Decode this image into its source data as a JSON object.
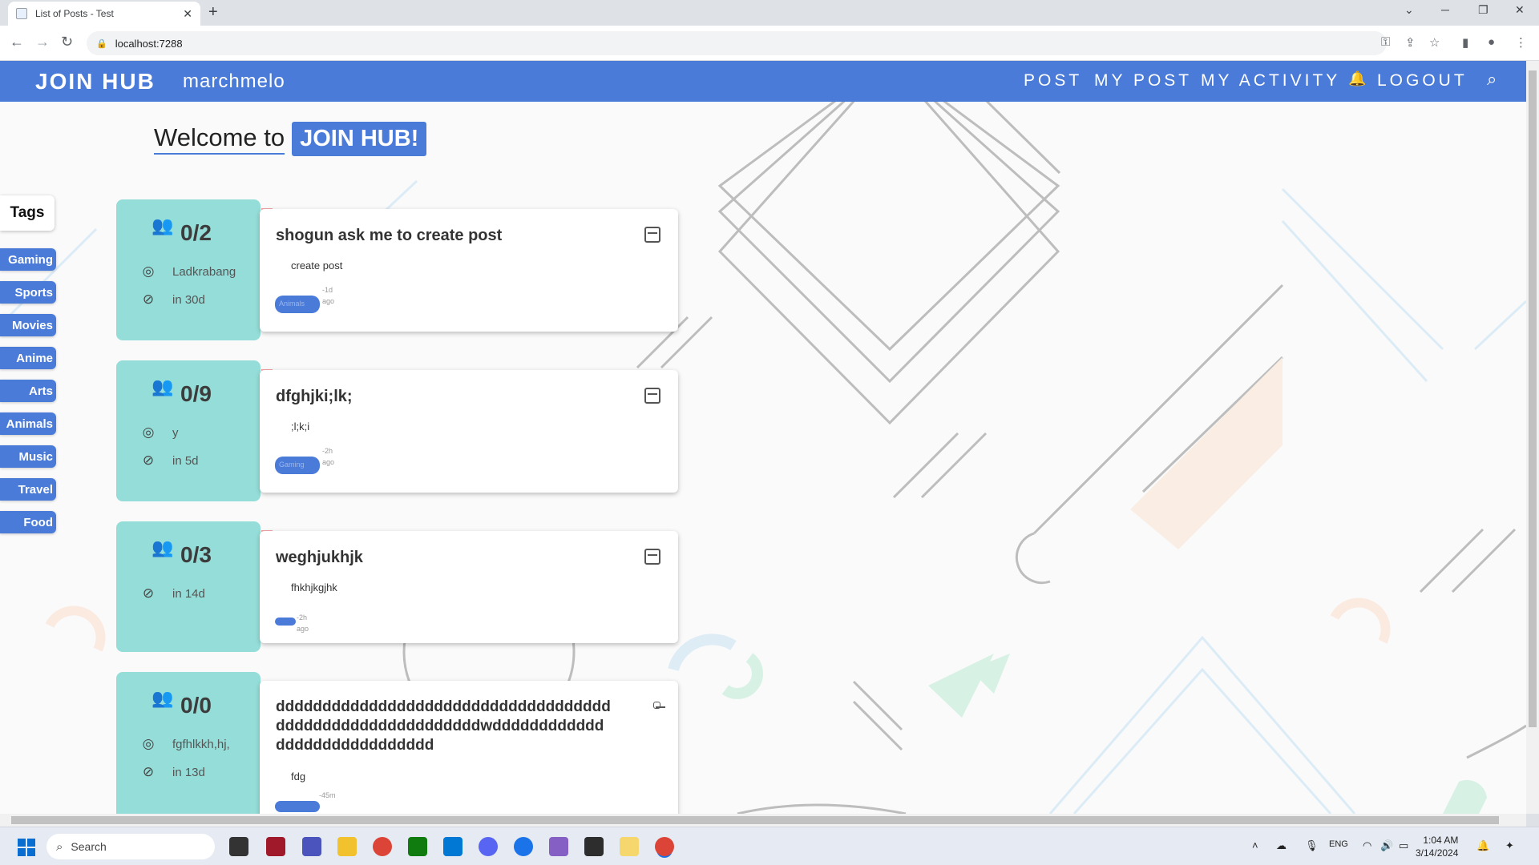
{
  "browser": {
    "tab_title": "List of Posts - Test",
    "tab_close": "✕",
    "new_tab": "+",
    "url": "localhost:7288",
    "window_controls": [
      "⌄",
      "─",
      "❐",
      "✕"
    ]
  },
  "navbar": {
    "brand": "JOIN HUB",
    "username": "marchmelo",
    "links": [
      "POST",
      "MY POST",
      "MY ACTIVITY",
      "LOGOUT"
    ]
  },
  "welcome": {
    "prefix": "Welcome to",
    "highlight": "JOIN HUB!"
  },
  "tags": {
    "header": "Tags",
    "items": [
      "Gaming",
      "Sports",
      "Movies",
      "Anime",
      "Arts",
      "Animals",
      "Music",
      "Travel",
      "Food"
    ]
  },
  "posts": [
    {
      "count": "0/2",
      "location": "Ladkrabang",
      "deadline": "in 30d",
      "title": "shogun ask me to create post",
      "description": "create post",
      "tag": "Animals",
      "time": "-1d",
      "time_suffix": "ago"
    },
    {
      "count": "0/9",
      "location": "y",
      "deadline": "in 5d",
      "title": "dfghjki;lk;",
      "description": ";l;k;i",
      "tag": "Gaming",
      "time": "-2h",
      "time_suffix": "ago"
    },
    {
      "count": "0/3",
      "location": "",
      "deadline": "in 14d",
      "title": "weghjukhjk",
      "description": "fhkhjkgjhk",
      "tag": "",
      "time": "-2h",
      "time_suffix": "ago"
    },
    {
      "count": "0/0",
      "location": "fgfhlkkh,hj,",
      "deadline": "in 13d",
      "title": "ddddddddddddddddddddddddddddddddddddddddddddddddddddddddddwddddddddddddddddddddddddddddd",
      "description": "fdg",
      "tag": "",
      "time": "-45m",
      "time_suffix": ""
    }
  ],
  "taskbar": {
    "search_placeholder": "Search",
    "language": "ENG",
    "time": "1:04 AM",
    "date": "3/14/2024"
  },
  "colors": {
    "brand": "#4a7bd9",
    "card_left": "#95ddd8"
  }
}
